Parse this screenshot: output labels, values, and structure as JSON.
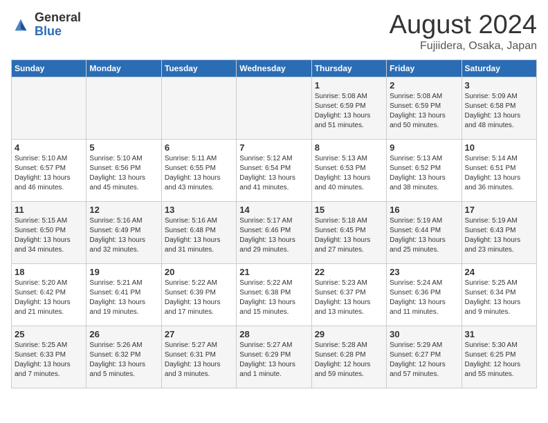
{
  "header": {
    "logo_general": "General",
    "logo_blue": "Blue",
    "month_title": "August 2024",
    "subtitle": "Fujiidera, Osaka, Japan"
  },
  "days_of_week": [
    "Sunday",
    "Monday",
    "Tuesday",
    "Wednesday",
    "Thursday",
    "Friday",
    "Saturday"
  ],
  "weeks": [
    [
      {
        "day": "",
        "detail": ""
      },
      {
        "day": "",
        "detail": ""
      },
      {
        "day": "",
        "detail": ""
      },
      {
        "day": "",
        "detail": ""
      },
      {
        "day": "1",
        "detail": "Sunrise: 5:08 AM\nSunset: 6:59 PM\nDaylight: 13 hours\nand 51 minutes."
      },
      {
        "day": "2",
        "detail": "Sunrise: 5:08 AM\nSunset: 6:59 PM\nDaylight: 13 hours\nand 50 minutes."
      },
      {
        "day": "3",
        "detail": "Sunrise: 5:09 AM\nSunset: 6:58 PM\nDaylight: 13 hours\nand 48 minutes."
      }
    ],
    [
      {
        "day": "4",
        "detail": "Sunrise: 5:10 AM\nSunset: 6:57 PM\nDaylight: 13 hours\nand 46 minutes."
      },
      {
        "day": "5",
        "detail": "Sunrise: 5:10 AM\nSunset: 6:56 PM\nDaylight: 13 hours\nand 45 minutes."
      },
      {
        "day": "6",
        "detail": "Sunrise: 5:11 AM\nSunset: 6:55 PM\nDaylight: 13 hours\nand 43 minutes."
      },
      {
        "day": "7",
        "detail": "Sunrise: 5:12 AM\nSunset: 6:54 PM\nDaylight: 13 hours\nand 41 minutes."
      },
      {
        "day": "8",
        "detail": "Sunrise: 5:13 AM\nSunset: 6:53 PM\nDaylight: 13 hours\nand 40 minutes."
      },
      {
        "day": "9",
        "detail": "Sunrise: 5:13 AM\nSunset: 6:52 PM\nDaylight: 13 hours\nand 38 minutes."
      },
      {
        "day": "10",
        "detail": "Sunrise: 5:14 AM\nSunset: 6:51 PM\nDaylight: 13 hours\nand 36 minutes."
      }
    ],
    [
      {
        "day": "11",
        "detail": "Sunrise: 5:15 AM\nSunset: 6:50 PM\nDaylight: 13 hours\nand 34 minutes."
      },
      {
        "day": "12",
        "detail": "Sunrise: 5:16 AM\nSunset: 6:49 PM\nDaylight: 13 hours\nand 32 minutes."
      },
      {
        "day": "13",
        "detail": "Sunrise: 5:16 AM\nSunset: 6:48 PM\nDaylight: 13 hours\nand 31 minutes."
      },
      {
        "day": "14",
        "detail": "Sunrise: 5:17 AM\nSunset: 6:46 PM\nDaylight: 13 hours\nand 29 minutes."
      },
      {
        "day": "15",
        "detail": "Sunrise: 5:18 AM\nSunset: 6:45 PM\nDaylight: 13 hours\nand 27 minutes."
      },
      {
        "day": "16",
        "detail": "Sunrise: 5:19 AM\nSunset: 6:44 PM\nDaylight: 13 hours\nand 25 minutes."
      },
      {
        "day": "17",
        "detail": "Sunrise: 5:19 AM\nSunset: 6:43 PM\nDaylight: 13 hours\nand 23 minutes."
      }
    ],
    [
      {
        "day": "18",
        "detail": "Sunrise: 5:20 AM\nSunset: 6:42 PM\nDaylight: 13 hours\nand 21 minutes."
      },
      {
        "day": "19",
        "detail": "Sunrise: 5:21 AM\nSunset: 6:41 PM\nDaylight: 13 hours\nand 19 minutes."
      },
      {
        "day": "20",
        "detail": "Sunrise: 5:22 AM\nSunset: 6:39 PM\nDaylight: 13 hours\nand 17 minutes."
      },
      {
        "day": "21",
        "detail": "Sunrise: 5:22 AM\nSunset: 6:38 PM\nDaylight: 13 hours\nand 15 minutes."
      },
      {
        "day": "22",
        "detail": "Sunrise: 5:23 AM\nSunset: 6:37 PM\nDaylight: 13 hours\nand 13 minutes."
      },
      {
        "day": "23",
        "detail": "Sunrise: 5:24 AM\nSunset: 6:36 PM\nDaylight: 13 hours\nand 11 minutes."
      },
      {
        "day": "24",
        "detail": "Sunrise: 5:25 AM\nSunset: 6:34 PM\nDaylight: 13 hours\nand 9 minutes."
      }
    ],
    [
      {
        "day": "25",
        "detail": "Sunrise: 5:25 AM\nSunset: 6:33 PM\nDaylight: 13 hours\nand 7 minutes."
      },
      {
        "day": "26",
        "detail": "Sunrise: 5:26 AM\nSunset: 6:32 PM\nDaylight: 13 hours\nand 5 minutes."
      },
      {
        "day": "27",
        "detail": "Sunrise: 5:27 AM\nSunset: 6:31 PM\nDaylight: 13 hours\nand 3 minutes."
      },
      {
        "day": "28",
        "detail": "Sunrise: 5:27 AM\nSunset: 6:29 PM\nDaylight: 13 hours\nand 1 minute."
      },
      {
        "day": "29",
        "detail": "Sunrise: 5:28 AM\nSunset: 6:28 PM\nDaylight: 12 hours\nand 59 minutes."
      },
      {
        "day": "30",
        "detail": "Sunrise: 5:29 AM\nSunset: 6:27 PM\nDaylight: 12 hours\nand 57 minutes."
      },
      {
        "day": "31",
        "detail": "Sunrise: 5:30 AM\nSunset: 6:25 PM\nDaylight: 12 hours\nand 55 minutes."
      }
    ]
  ]
}
